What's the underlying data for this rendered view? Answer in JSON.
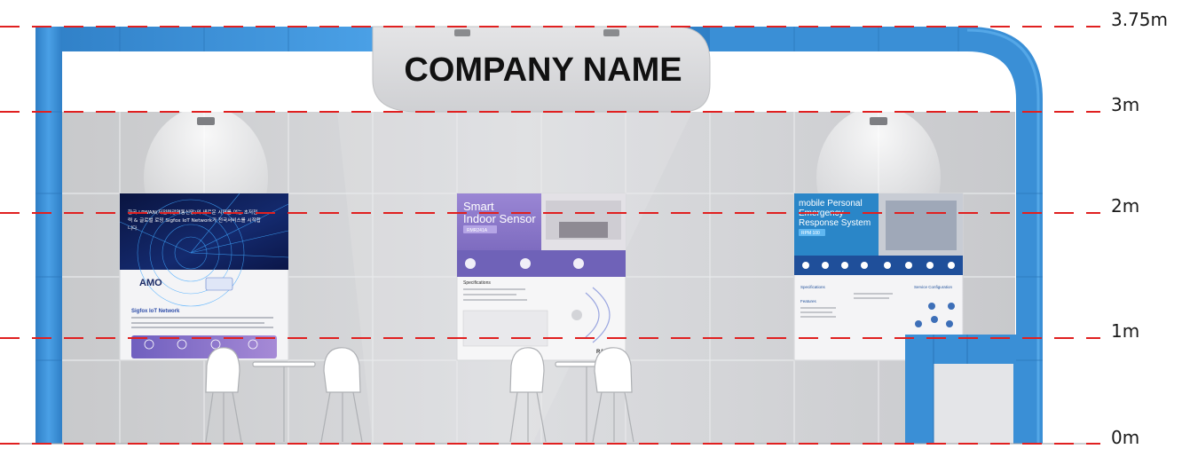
{
  "sign": {
    "company_name": "COMPANY NAME"
  },
  "levels": [
    {
      "label": "3.75m"
    },
    {
      "label": "3m"
    },
    {
      "label": "2m"
    },
    {
      "label": "1m"
    },
    {
      "label": "0m"
    }
  ],
  "posters": {
    "left": {
      "headline": "한국 LPWAN(저전력광역통신망)의 새로운 시대를 여는 초저전력 & 글로벌 로밍 Sigfox IoT Network가 전국서비스를 시작합니다.",
      "brand": "AMO",
      "section_title": "Sigfox IoT Network"
    },
    "center": {
      "title_line1": "Smart",
      "title_line2": "Indoor Sensor",
      "model": "RMR241A",
      "section_title": "Specifications",
      "brand": "RANIX"
    },
    "right": {
      "title_line1": "mobile Personal",
      "title_line2": "Emergency",
      "title_line3": "Response System",
      "model": "RPM 100",
      "section_specs": "Specifications",
      "section_features": "Features",
      "section_config": "Service Configuration"
    }
  },
  "colors": {
    "frame_blue": "#3a8fd6",
    "wall_grey": "#c9cacc",
    "dashed_line": "#e02020",
    "poster_navy": "#0e1a4a",
    "poster_purple": "#8d7ac9"
  }
}
